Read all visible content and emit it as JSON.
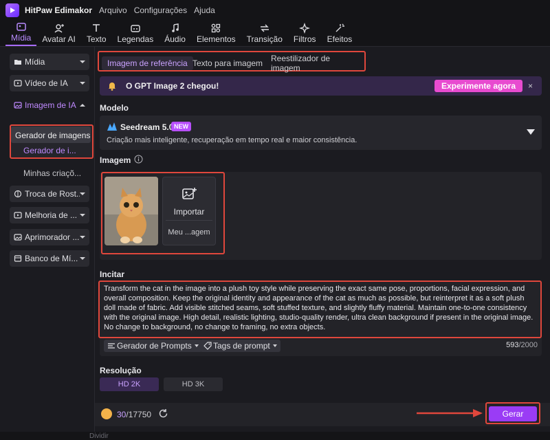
{
  "app": {
    "title": "HitPaw Edimakor",
    "menus": [
      "Arquivo",
      "Configurações",
      "Ajuda"
    ]
  },
  "toolbar": {
    "items": [
      "Mídia",
      "Avatar AI",
      "Texto",
      "Legendas",
      "Áudio",
      "Elementos",
      "Transição",
      "Filtros",
      "Efeitos"
    ],
    "active": "Mídia"
  },
  "sidebar": {
    "items": [
      "Mídia",
      "Vídeo de IA",
      "Imagem de IA",
      "Troca de Rost...",
      "Melhoria de ...",
      "Aprimorador ...",
      "Banco de Mí..."
    ],
    "submenu": {
      "tooltip": "Gerador de imagens",
      "active": "Gerador de i...",
      "other": "Minhas criaçõ..."
    }
  },
  "tabs": {
    "items": [
      "Imagem de referência",
      "Texto para imagem",
      "Reestilizador de imagem"
    ],
    "active": "Imagem de referência"
  },
  "banner": {
    "text": "O GPT Image 2 chegou!",
    "button": "Experimente agora",
    "close": "×"
  },
  "model": {
    "section": "Modelo",
    "name": "Seedream 5.0",
    "badge": "NEW",
    "description": "Criação mais inteligente, recuperação em tempo real e maior consistência."
  },
  "image": {
    "section": "Imagem",
    "import_label": "Importar",
    "my_label": "Meu ...agem"
  },
  "prompt": {
    "section": "Incitar",
    "text": "Transform the cat in the image into a plush toy style while preserving the exact same pose, proportions, facial expression, and overall composition. Keep the original identity and appearance of the cat as much as possible, but reinterpret it as a soft plush doll made of fabric. Add visible stitched seams, soft stuffed texture, and slightly fluffy material. Maintain one-to-one consistency with the original image. High detail, realistic lighting, studio-quality render, ultra clean background if present in the original image. No change to background, no change to framing, no extra objects.",
    "prompt_generator": "Gerador de Prompts",
    "prompt_tags": "Tags de prompt",
    "count": "593",
    "max": "/2000"
  },
  "resolution": {
    "section": "Resolução",
    "options": [
      "HD 2K",
      "HD 3K"
    ],
    "active": "HD 2K"
  },
  "footer": {
    "credits_used": "30",
    "credits_total": "/17750",
    "generate": "Gerar",
    "footer_text": "Dividir"
  },
  "colors": {
    "accent": "#9a3cf5",
    "highlight": "#e0473c",
    "banner_btn": "#e84bd0"
  }
}
